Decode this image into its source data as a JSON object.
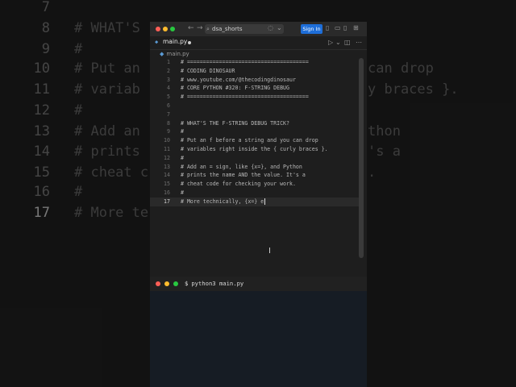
{
  "background_editor": {
    "lines": [
      {
        "num": "7",
        "code": "",
        "active": false
      },
      {
        "num": "8",
        "code": "# WHAT'S",
        "active": false
      },
      {
        "num": "9",
        "code": "#",
        "active": false
      },
      {
        "num": "10",
        "code": "# Put an",
        "active": false
      },
      {
        "num": "11",
        "code": "# variab",
        "active": false
      },
      {
        "num": "12",
        "code": "#",
        "active": false
      },
      {
        "num": "13",
        "code": "# Add an",
        "active": false
      },
      {
        "num": "14",
        "code": "# prints",
        "active": false
      },
      {
        "num": "15",
        "code": "# cheat c",
        "active": false
      },
      {
        "num": "16",
        "code": "#",
        "active": false
      },
      {
        "num": "17",
        "code": "# More te",
        "active": true
      }
    ],
    "right_fragments": [
      {
        "text": "can drop"
      },
      {
        "text": "y braces }."
      },
      {
        "text": "thon"
      },
      {
        "text": "'s a"
      },
      {
        "text": "."
      }
    ]
  },
  "titlebar": {
    "search_text": "dsa_shorts",
    "sign_in_label": "Sign In",
    "colors": {
      "close": "#ff5f57",
      "minimize": "#febc2e",
      "maximize": "#28c840",
      "accent": "#1e6ed8"
    }
  },
  "tab": {
    "label": "main.py",
    "icon": "python-file-icon"
  },
  "breadcrumb": {
    "label": "main.py"
  },
  "editor": {
    "lines": [
      {
        "num": "1",
        "code": "# ======================================"
      },
      {
        "num": "2",
        "code": "# CODING DINOSAUR"
      },
      {
        "num": "3",
        "code": "# www.youtube.com/@thecodingdinosaur"
      },
      {
        "num": "4",
        "code": "# CORE PYTHON #320: F-STRING DEBUG"
      },
      {
        "num": "5",
        "code": "# ======================================"
      },
      {
        "num": "6",
        "code": ""
      },
      {
        "num": "7",
        "code": ""
      },
      {
        "num": "8",
        "code": "# WHAT'S THE F-STRING DEBUG TRICK?"
      },
      {
        "num": "9",
        "code": "#"
      },
      {
        "num": "10",
        "code": "# Put an f before a string and you can drop"
      },
      {
        "num": "11",
        "code": "# variables right inside the { curly braces }."
      },
      {
        "num": "12",
        "code": "#"
      },
      {
        "num": "13",
        "code": "# Add an = sign, like {x=}, and Python"
      },
      {
        "num": "14",
        "code": "# prints the name AND the value. It's a"
      },
      {
        "num": "15",
        "code": "# cheat code for checking your work."
      },
      {
        "num": "16",
        "code": "#"
      },
      {
        "num": "17",
        "code": "# More technically, {x=} e"
      }
    ],
    "active_line": 17
  },
  "terminal": {
    "prompt": "$",
    "command": "python3 main.py"
  }
}
